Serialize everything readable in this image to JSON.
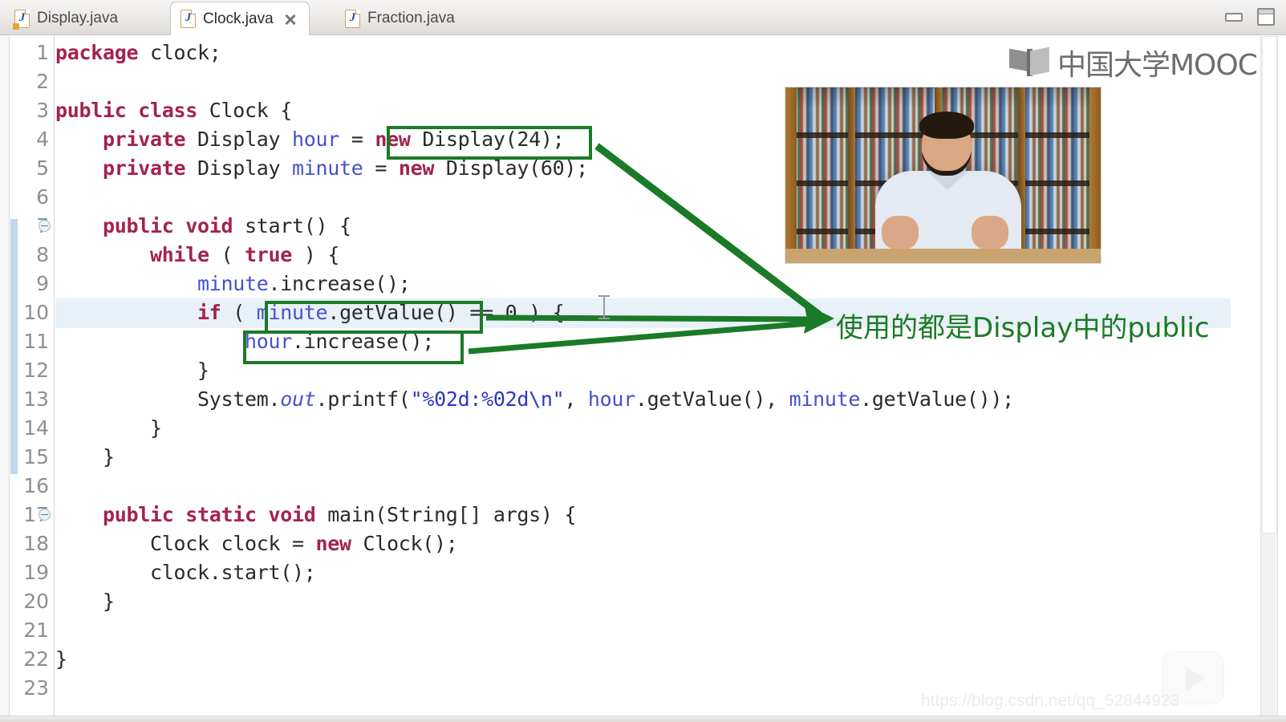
{
  "window": {
    "minimize_label": "minimize",
    "maximize_label": "maximize"
  },
  "tabs": [
    {
      "label": "Display.java",
      "active": false,
      "has_warning": true
    },
    {
      "label": "Clock.java",
      "active": true,
      "has_warning": false
    },
    {
      "label": "Fraction.java",
      "active": false,
      "has_warning": false
    }
  ],
  "editor": {
    "active_file": "Clock.java",
    "current_line": 10,
    "first_visible_line": 1,
    "last_visible_line": 23,
    "line_numbers": [
      "1",
      "2",
      "3",
      "4",
      "5",
      "6",
      "7",
      "8",
      "9",
      "10",
      "11",
      "12",
      "13",
      "14",
      "15",
      "16",
      "17",
      "18",
      "19",
      "20",
      "21",
      "22",
      "23"
    ],
    "fold_markers": [
      7,
      17
    ],
    "code_lines": [
      {
        "n": 1,
        "text": "package clock;"
      },
      {
        "n": 2,
        "text": ""
      },
      {
        "n": 3,
        "text": "public class Clock {"
      },
      {
        "n": 4,
        "text": "    private Display hour = new Display(24);"
      },
      {
        "n": 5,
        "text": "    private Display minute = new Display(60);"
      },
      {
        "n": 6,
        "text": ""
      },
      {
        "n": 7,
        "text": "    public void start() {"
      },
      {
        "n": 8,
        "text": "        while ( true ) {"
      },
      {
        "n": 9,
        "text": "            minute.increase();"
      },
      {
        "n": 10,
        "text": "            if ( minute.getValue() == 0 ) {"
      },
      {
        "n": 11,
        "text": "                hour.increase();"
      },
      {
        "n": 12,
        "text": "            }"
      },
      {
        "n": 13,
        "text": "            System.out.printf(\"%02d:%02d\\n\", hour.getValue(), minute.getValue());"
      },
      {
        "n": 14,
        "text": "        }"
      },
      {
        "n": 15,
        "text": "    }"
      },
      {
        "n": 16,
        "text": ""
      },
      {
        "n": 17,
        "text": "    public static void main(String[] args) {"
      },
      {
        "n": 18,
        "text": "        Clock clock = new Clock();"
      },
      {
        "n": 19,
        "text": "        clock.start();"
      },
      {
        "n": 20,
        "text": "    }"
      },
      {
        "n": 21,
        "text": ""
      },
      {
        "n": 22,
        "text": "}"
      },
      {
        "n": 23,
        "text": ""
      }
    ]
  },
  "annotations": {
    "color": "#1b7a27",
    "text": "使用的都是Display中的public",
    "boxes": [
      {
        "id": "box-new-display-24",
        "target": "new Display(24);"
      },
      {
        "id": "box-minute-getvalue",
        "target": "minute.getValue()"
      },
      {
        "id": "box-hour-increase",
        "target": "hour.increase();"
      }
    ]
  },
  "branding": {
    "logo_text": "中国大学MOOC"
  },
  "watermark": {
    "url": "https://blog.csdn.net/qq_52844923"
  }
}
